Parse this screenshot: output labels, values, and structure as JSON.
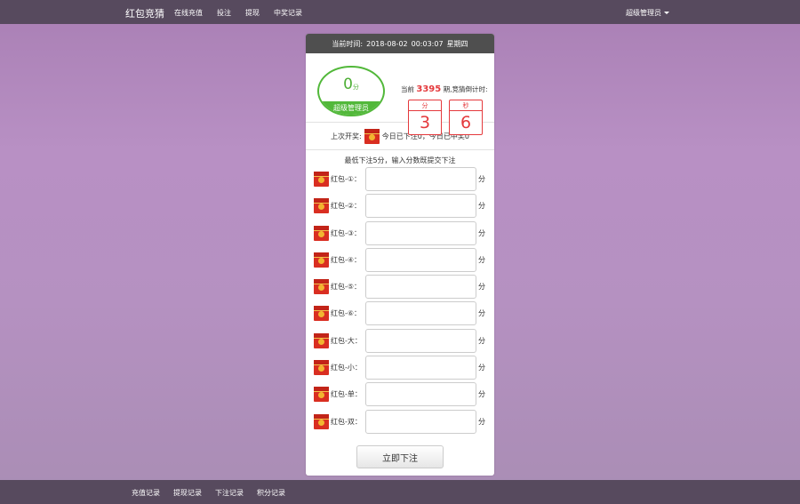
{
  "nav": {
    "brand": "红包竞猜",
    "links": [
      "在线充值",
      "投注",
      "提现",
      "中奖记录"
    ],
    "user": "超级管理员"
  },
  "header": {
    "time_label": "当前时间:",
    "date": "2018-08-02",
    "time": "00:03:07",
    "weekday": "星期四"
  },
  "score": {
    "value": "0",
    "unit": "分",
    "role": "超级管理员"
  },
  "period": {
    "prefix": "当前",
    "number": "3395",
    "suffix": "期,竞猜倒计时:"
  },
  "countdown": {
    "min_label": "分",
    "min_value": "3",
    "sec_label": "秒",
    "sec_value": "6"
  },
  "last": {
    "prefix": "上次开奖:",
    "text": "今日已下注0，今日已中奖0"
  },
  "rule": "最低下注5分，输入分数既提交下注",
  "bets": [
    {
      "label": "红包-①：",
      "value": "",
      "unit": "分"
    },
    {
      "label": "红包-②：",
      "value": "",
      "unit": "分"
    },
    {
      "label": "红包-③：",
      "value": "",
      "unit": "分"
    },
    {
      "label": "红包-④：",
      "value": "",
      "unit": "分"
    },
    {
      "label": "红包-⑤：",
      "value": "",
      "unit": "分"
    },
    {
      "label": "红包-⑥：",
      "value": "",
      "unit": "分"
    },
    {
      "label": "红包-大：",
      "value": "",
      "unit": "分"
    },
    {
      "label": "红包-小：",
      "value": "",
      "unit": "分"
    },
    {
      "label": "红包-单：",
      "value": "",
      "unit": "分"
    },
    {
      "label": "红包-双：",
      "value": "",
      "unit": "分"
    }
  ],
  "submit": "立即下注",
  "footer": {
    "links": [
      "充值记录",
      "提现记录",
      "下注记录",
      "积分记录"
    ]
  },
  "colors": {
    "accent_green": "#52b83a",
    "accent_red": "#e4393c",
    "bar": "#574a5e",
    "background": "#b590c1"
  },
  "icons": {
    "red_packet": "red-packet-icon",
    "caret": "caret-down-icon"
  }
}
